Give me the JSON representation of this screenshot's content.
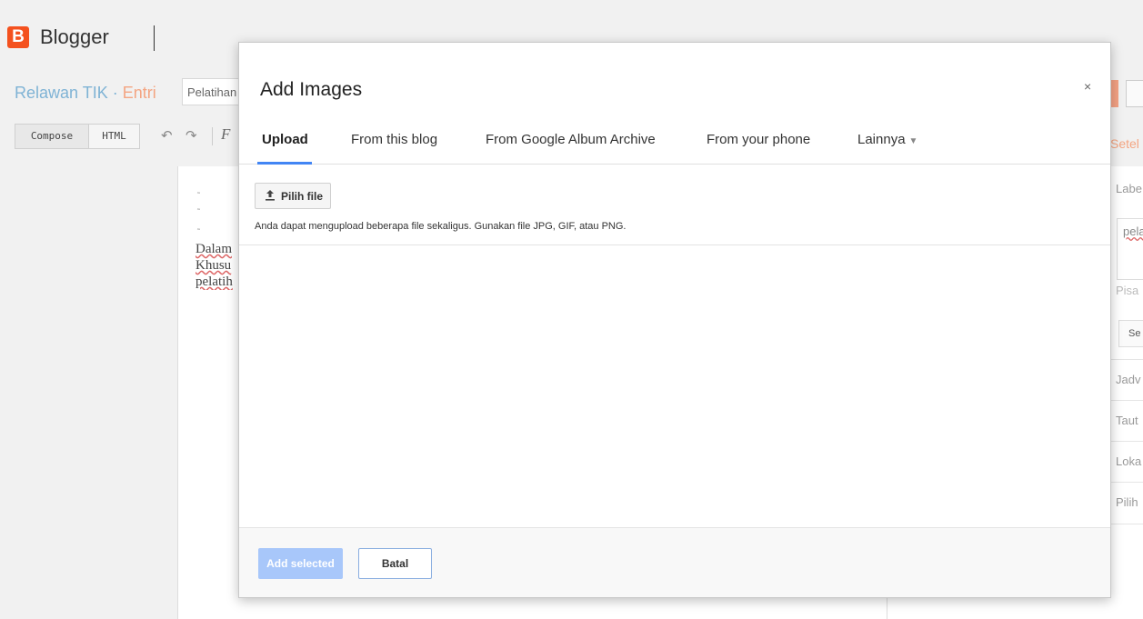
{
  "app": {
    "logo_letter": "B",
    "name": "Blogger"
  },
  "breadcrumb": {
    "blog": "Relawan TIK",
    "separator": "·",
    "entry": "Entri"
  },
  "post_title_value": "Pelatihan",
  "editor_toolbar": {
    "compose_label": "Compose",
    "html_label": "HTML"
  },
  "editor_content": {
    "lines": [
      "Dalam",
      "Khusu",
      "pelatih"
    ]
  },
  "right_panel": {
    "title": "Setel",
    "items": [
      "Labe",
      "Pisa",
      "Se",
      "Jadv",
      "Taut",
      "Loka",
      "Pilih"
    ],
    "labels_value": "pela"
  },
  "modal": {
    "title": "Add Images",
    "close": "×",
    "tabs": [
      {
        "label": "Upload",
        "active": true
      },
      {
        "label": "From this blog",
        "active": false
      },
      {
        "label": "From Google Album Archive",
        "active": false
      },
      {
        "label": "From your phone",
        "active": false
      },
      {
        "label": "Lainnya",
        "active": false
      }
    ],
    "pick_file_label": "Pilih file",
    "hint": "Anda dapat mengupload beberapa file sekaligus. Gunakan file JPG, GIF, atau PNG.",
    "add_selected_label": "Add selected",
    "cancel_label": "Batal"
  },
  "colors": {
    "brand": "#f4511e",
    "accent": "#4285f4",
    "disabled_button": "#a8c7fa"
  }
}
